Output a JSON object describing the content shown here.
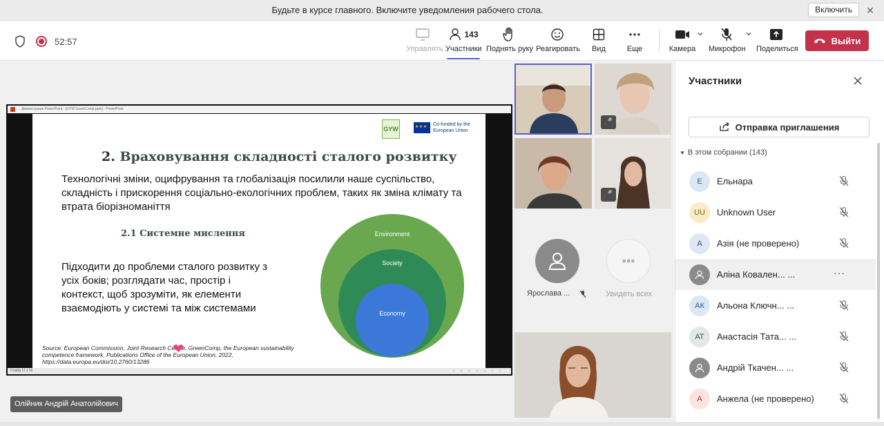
{
  "notification": {
    "text": "Будьте в курсе главного. Включите уведомления рабочего стола.",
    "enable_button": "Включить",
    "close_glyph": "✕"
  },
  "toolbar": {
    "timer": "52:57",
    "participant_count": "143",
    "buttons": {
      "manage": "Управлять",
      "participants": "Участники",
      "raise_hand": "Поднять руку",
      "react": "Реагировать",
      "view": "Вид",
      "more": "Еще",
      "camera": "Камера",
      "mic": "Микрофон",
      "share": "Поделиться"
    },
    "leave": "Выйти"
  },
  "slide": {
    "ppt_bar_text": "Демонстрація PowerPoint - [GYW GreenComp.pptx] - PowerPoint",
    "status_text": "Слайд 11 з 16",
    "logo_text": "GYW",
    "eu_text_line1": "Co-funded by the",
    "eu_text_line2": "European Union",
    "title_num": "2.",
    "title_text": "Враховування складності сталого розвитку",
    "body": "Технологічні зміни, оцифрування та глобалізація посилили наше суспільство, складність і прискорення соціально-екологічних проблем, таких як зміна клімату та втрата біорізноманіття",
    "subtitle_num": "2.1",
    "subtitle_text": "Системне мислення",
    "paragraph": "Підходити до проблеми сталого розвитку з усіх боків; розглядати час, простір і контекст, щоб зрозуміти, як елементи взаємодіють у системі та між системами",
    "source": "Source: European Commission, Joint Research Centre, GreenComp, the European sustainability competence framework, Publications Office of the European Union, 2022, https://data.europa.eu/doi/10.2760/13286",
    "diagram": {
      "outer": "Environment",
      "middle": "Society",
      "inner": "Economy"
    }
  },
  "tiles": {
    "yaroslava_name": "Ярослава ...",
    "see_all": "Увидеть всех",
    "more_glyph": "•••"
  },
  "presenter_name": "Олійник Андрій Анатолійович",
  "panel": {
    "title": "Участники",
    "invite": "Отправка приглашения",
    "section": "В этом собрании (143)",
    "participants": [
      {
        "initials": "Е",
        "name": "Ельнара",
        "bg": "#dbe7f5",
        "fg": "#315c8c"
      },
      {
        "initials": "UU",
        "name": "Unknown User",
        "bg": "#f9ebc8",
        "fg": "#8a6412"
      },
      {
        "initials": "А",
        "name": "Азія (не проверено)",
        "bg": "#dfe6f4",
        "fg": "#354c80"
      },
      {
        "initials": "",
        "name": "Аліна Ковален... ...",
        "bg": "#8a8a8a",
        "fg": "#ffffff"
      },
      {
        "initials": "АК",
        "name": "Альона Ключн... ...",
        "bg": "#dbe7f5",
        "fg": "#315c8c"
      },
      {
        "initials": "АТ",
        "name": "Анастасія Тата... ...",
        "bg": "#e4e8e4",
        "fg": "#3b5240"
      },
      {
        "initials": "",
        "name": "Андрій Ткачен... ...",
        "bg": "#8a8a8a",
        "fg": "#ffffff"
      },
      {
        "initials": "А",
        "name": "Анжела (не проверено)",
        "bg": "#fbe4e0",
        "fg": "#a4372a"
      }
    ]
  },
  "colors": {
    "leave": "#c4314b",
    "accent": "#5b5fc7",
    "environment": "#6aa84f",
    "society": "#2e8b57",
    "economy": "#3c78d8"
  }
}
